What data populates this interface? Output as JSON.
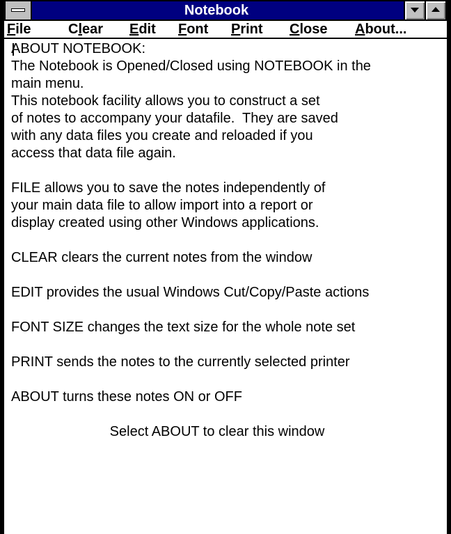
{
  "window": {
    "title": "Notebook"
  },
  "menu": {
    "file": {
      "accel": "F",
      "rest": "ile"
    },
    "clear": {
      "pre": "C",
      "accel": "l",
      "rest": "ear"
    },
    "edit": {
      "accel": "E",
      "rest": "dit"
    },
    "font": {
      "accel": "F",
      "rest": "ont"
    },
    "print": {
      "accel": "P",
      "rest": "rint"
    },
    "close": {
      "accel": "C",
      "rest": "lose"
    },
    "about": {
      "accel": "A",
      "rest": "bout..."
    }
  },
  "notes": {
    "lines": [
      "ABOUT NOTEBOOK:",
      "The Notebook is Opened/Closed using NOTEBOOK in the",
      "main menu.",
      "This notebook facility allows you to construct a set",
      "of notes to accompany your datafile.  They are saved",
      "with any data files you create and reloaded if you",
      "access that data file again.",
      "",
      "FILE allows you to save the notes independently of",
      "your main data file to allow import into a report or",
      "display created using other Windows applications.",
      "",
      "CLEAR clears the current notes from the window",
      "",
      "EDIT provides the usual Windows Cut/Copy/Paste actions",
      "",
      "FONT SIZE changes the text size for the whole note set",
      "",
      "PRINT sends the notes to the currently selected printer",
      "",
      "ABOUT turns these notes ON or OFF",
      ""
    ],
    "footer": "Select ABOUT to clear this window"
  },
  "colors": {
    "titlebar": "#000080",
    "chrome": "#c0c0c0"
  },
  "icons": {
    "system_menu": "system-menu-icon",
    "minimize": "minimize-arrow-icon",
    "maximize": "maximize-arrow-icon"
  }
}
